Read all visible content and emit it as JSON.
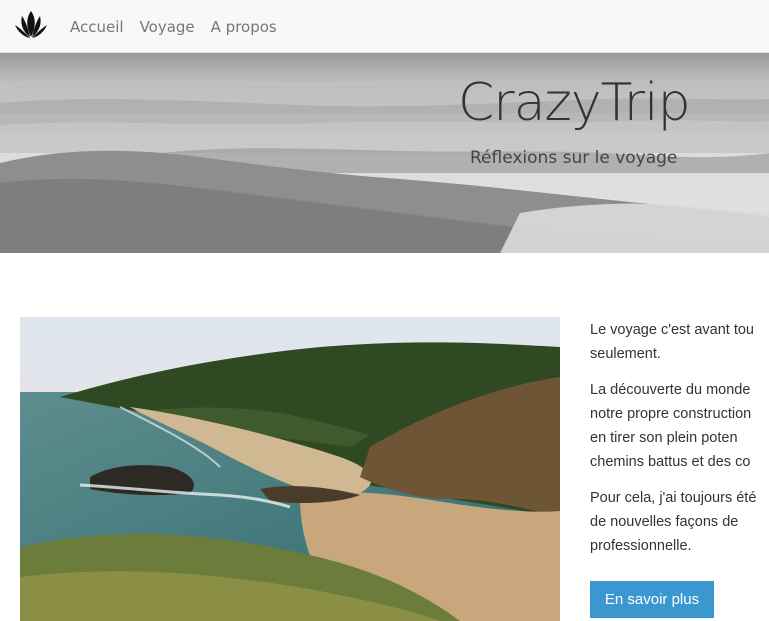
{
  "navbar": {
    "logo_icon": "lotus-logo-icon",
    "links": [
      {
        "label": "Accueil"
      },
      {
        "label": "Voyage"
      },
      {
        "label": "A propos"
      }
    ]
  },
  "hero": {
    "title": "CrazyTrip",
    "subtitle": "Réflexions sur le voyage"
  },
  "content": {
    "paragraphs": [
      {
        "lines": [
          "Le voyage c'est avant tou",
          "seulement."
        ]
      },
      {
        "lines": [
          "La découverte du monde",
          "notre propre construction",
          "en tirer son plein poten",
          "chemins battus et des co"
        ]
      },
      {
        "lines": [
          "Pour cela, j'ai toujours été",
          "de nouvelles façons de",
          "professionnelle."
        ]
      }
    ],
    "button_label": "En savoir plus"
  },
  "colors": {
    "navbar_bg": "#f8f8f8",
    "nav_link": "#777777",
    "button_bg": "#3a97cf",
    "text": "#333333"
  }
}
